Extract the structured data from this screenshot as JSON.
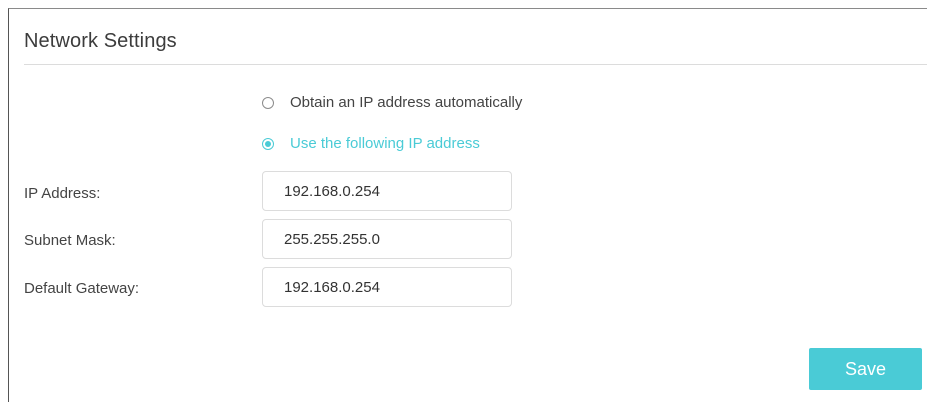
{
  "section": {
    "title": "Network Settings"
  },
  "ip_mode": {
    "options": [
      {
        "label": "Obtain an IP address automatically",
        "selected": false
      },
      {
        "label": "Use the following IP address",
        "selected": true
      }
    ]
  },
  "fields": {
    "ip_address": {
      "label": "IP Address:",
      "value": "192.168.0.254"
    },
    "subnet_mask": {
      "label": "Subnet Mask:",
      "value": "255.255.255.0"
    },
    "default_gateway": {
      "label": "Default Gateway:",
      "value": "192.168.0.254"
    }
  },
  "actions": {
    "save_label": "Save"
  },
  "colors": {
    "accent": "#4acbd6",
    "text": "#444444",
    "border": "#dcdcdc"
  }
}
